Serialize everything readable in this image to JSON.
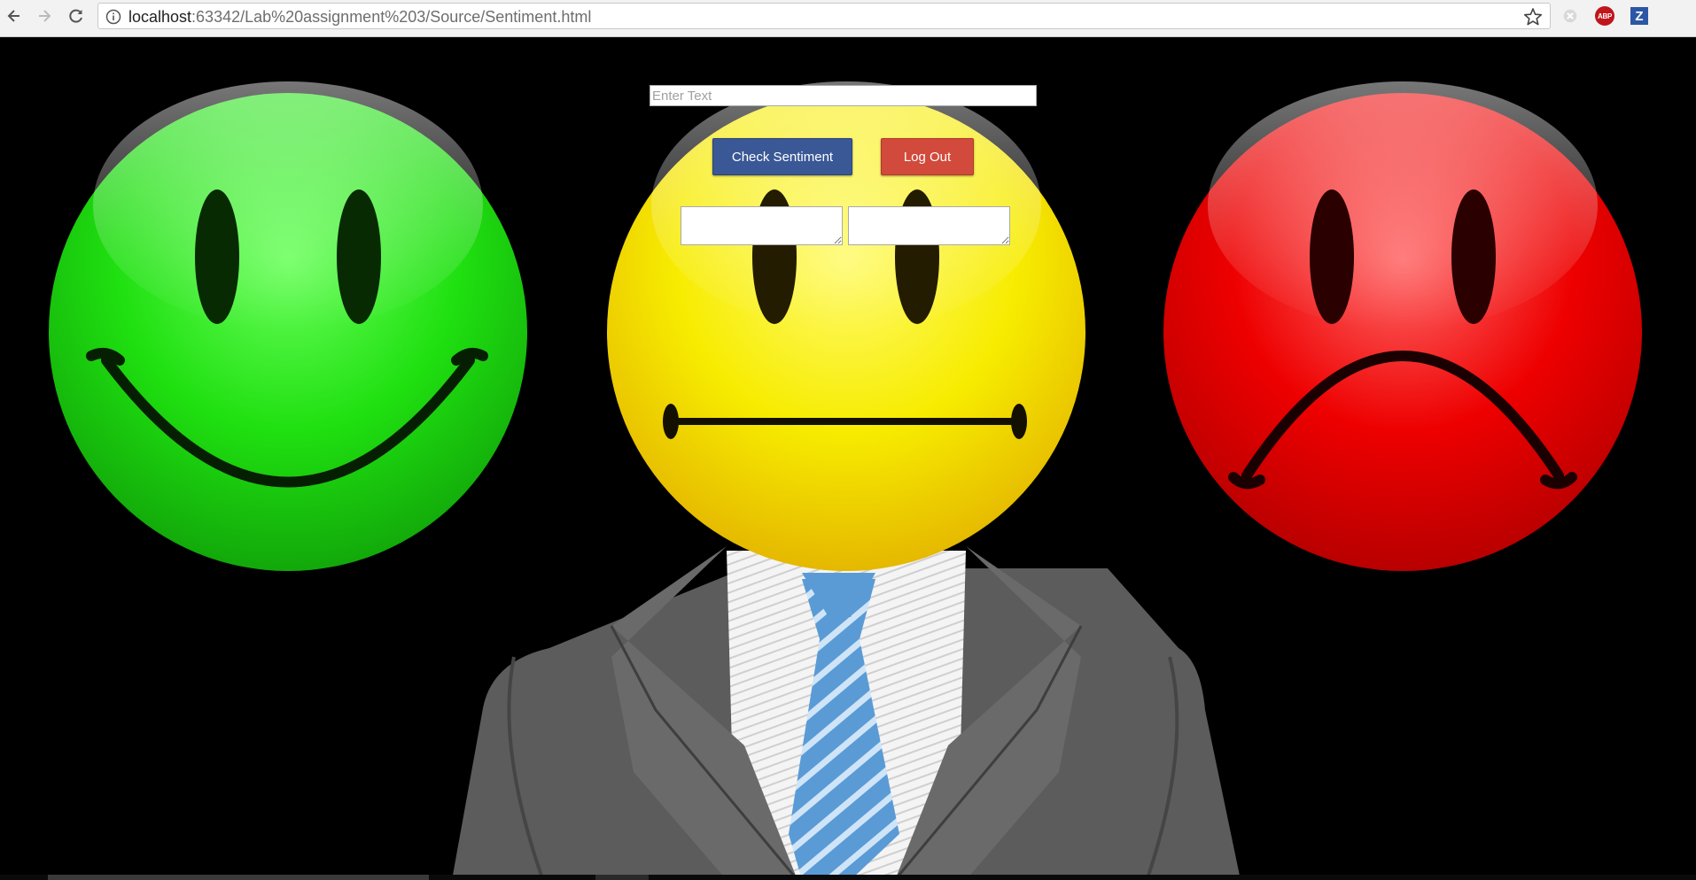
{
  "browser": {
    "url_host": "localhost",
    "url_rest": ":63342/Lab%20assignment%203/Source/Sentiment.html",
    "back_icon": "arrow-left-icon",
    "forward_icon": "arrow-right-icon",
    "reload_icon": "reload-icon",
    "info_icon": "info-icon",
    "bookmark_icon": "star-icon",
    "extensions": [
      {
        "name": "blocked-extension-icon",
        "label": ""
      },
      {
        "name": "adblock-plus-icon",
        "label": "ABP"
      },
      {
        "name": "zotero-icon",
        "label": "Z"
      }
    ]
  },
  "form": {
    "input_placeholder": "Enter Text",
    "input_value": "",
    "check_label": "Check Sentiment",
    "logout_label": "Log Out",
    "result1_value": "",
    "result2_value": ""
  },
  "colors": {
    "happy": "#1fe010",
    "neutral": "#f7ec00",
    "sad": "#ee0000",
    "check_button": "#3a5896",
    "logout_button": "#d24a3b",
    "suit": "#5c5c5c",
    "tie": "#5a9bd6"
  },
  "illustrations": [
    "happy-face",
    "neutral-face-with-suit",
    "sad-face"
  ]
}
